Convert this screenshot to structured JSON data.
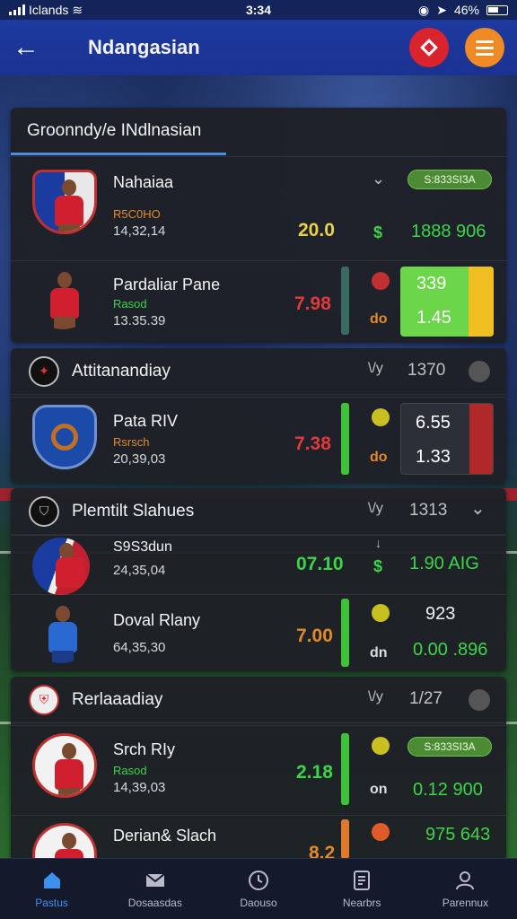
{
  "status": {
    "carrier": "Iclands",
    "time": "3:34",
    "battery": "46%"
  },
  "header": {
    "title": "Ndangasian"
  },
  "section1": {
    "title": "Groonndy/e INdlnasian"
  },
  "rows1": [
    {
      "name": "Nahaiaa",
      "sub": "R5C0HO",
      "date": "14,32,14",
      "odd": "20.0",
      "sym": "$",
      "right": "1888 906",
      "pill": "S:833SI3A"
    },
    {
      "name": "Pardaliar Pane",
      "sub": "Rasod",
      "date": "13.35.39",
      "odd": "7.98",
      "sym": "do",
      "box1": "339",
      "box2": "1.45"
    }
  ],
  "section2": {
    "title": "Attitanandiay",
    "mid": "1370"
  },
  "rows2": [
    {
      "name": "Pata RIV",
      "sub": "Rsrsch",
      "date": "20,39,03",
      "odd": "7.38",
      "sym": "do",
      "box1": "6.55",
      "box2": "1.33"
    }
  ],
  "section3": {
    "title": "Plemtilt Slahues",
    "mid": "1313"
  },
  "rows3": [
    {
      "name": "S9S3dun",
      "date": "24,35,04",
      "odd": "07.10",
      "sym": "$",
      "right": "1.90 AIG"
    },
    {
      "name": "Doval Rlany",
      "date": "64,35,30",
      "odd": "7.00",
      "sym": "dn",
      "top": "923",
      "right": "0.00 .896"
    }
  ],
  "section4": {
    "title": "Rerlaaadiay",
    "mid": "1/27"
  },
  "rows4": [
    {
      "name": "Srch RIy",
      "sub": "Rasod",
      "date": "14,39,03",
      "odd": "2.18",
      "sym": "on",
      "right": "0.12 900",
      "pill": "S:833SI3A"
    },
    {
      "name": "Derian& Slach",
      "odd": "8.2",
      "right": "975 643"
    }
  ],
  "nav": [
    {
      "label": "Pastus",
      "icon": "home-icon"
    },
    {
      "label": "Dosaasdas",
      "icon": "mail-icon"
    },
    {
      "label": "Daouso",
      "icon": "clock-icon"
    },
    {
      "label": "Nearbrs",
      "icon": "document-icon"
    },
    {
      "label": "Parennux",
      "icon": "profile-icon"
    }
  ]
}
